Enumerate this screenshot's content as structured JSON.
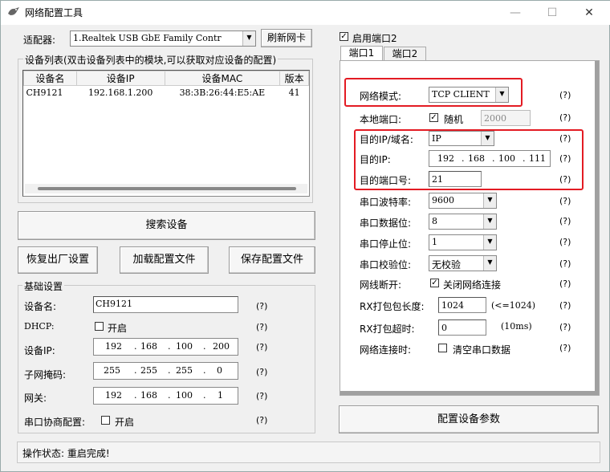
{
  "window": {
    "title": "网络配置工具"
  },
  "adapter": {
    "label": "适配器:",
    "value": "1.Realtek USB GbE Family Contr",
    "refresh_label": "刷新网卡"
  },
  "device_list": {
    "caption": "设备列表(双击设备列表中的模块,可以获取对应设备的配置)",
    "columns": [
      "设备名",
      "设备IP",
      "设备MAC",
      "版本"
    ],
    "rows": [
      [
        "CH9121",
        "192.168.1.200",
        "38:3B:26:44:E5:AE",
        "41"
      ]
    ]
  },
  "actions": {
    "search": "搜索设备",
    "factory_reset": "恢复出厂设置",
    "load_config": "加载配置文件",
    "save_config": "保存配置文件"
  },
  "basic": {
    "title": "基础设置",
    "device_name_label": "设备名:",
    "device_name": "CH9121",
    "dhcp_label": "DHCP:",
    "dhcp_check_label": "开启",
    "ip_label": "设备IP:",
    "ip": [
      "192",
      "168",
      "100",
      "200"
    ],
    "mask_label": "子网掩码:",
    "mask": [
      "255",
      "255",
      "255",
      "0"
    ],
    "gateway_label": "网关:",
    "gateway": [
      "192",
      "168",
      "100",
      "1"
    ],
    "negotiate_label": "串口协商配置:",
    "negotiate_check_label": "开启",
    "help": "(?)"
  },
  "status": {
    "text": "操作状态: 重启完成!"
  },
  "port": {
    "enable_label": "启用端口2",
    "tabs": [
      "端口1",
      "端口2"
    ],
    "net_mode_label": "网络模式:",
    "net_mode": "TCP CLIENT",
    "local_port_label": "本地端口:",
    "random_label": "随机",
    "local_port": "2000",
    "target_type_label": "目的IP/域名:",
    "target_type": "IP",
    "target_ip_label": "目的IP:",
    "target_ip": [
      "192",
      "168",
      "100",
      "111"
    ],
    "target_port_label": "目的端口号:",
    "target_port": "21",
    "baud_label": "串口波特率:",
    "baud": "9600",
    "data_bits_label": "串口数据位:",
    "data_bits": "8",
    "stop_bits_label": "串口停止位:",
    "stop_bits": "1",
    "parity_label": "串口校验位:",
    "parity": "无校验",
    "disconnect_label": "网线断开:",
    "disconnect_check_label": "关闭网络连接",
    "rx_len_label": "RX打包包长度:",
    "rx_len": "1024",
    "rx_len_hint": "(<=1024)",
    "rx_timeout_label": "RX打包超时:",
    "rx_timeout": "0",
    "rx_timeout_unit": "(10ms)",
    "connect_label": "网络连接时:",
    "clear_label": "清空串口数据",
    "help": "(?)"
  },
  "config_button": "配置设备参数",
  "colors": {
    "highlight": "#e31b23"
  }
}
